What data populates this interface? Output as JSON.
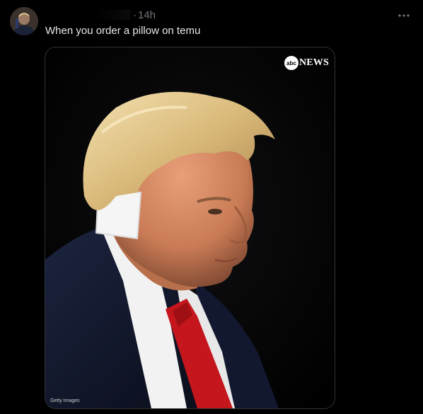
{
  "tweet": {
    "timestamp": "14h",
    "separator": "·",
    "text": "When you order a pillow on temu",
    "more_icon": "more-horizontal-icon",
    "avatar_icon": "avatar"
  },
  "media": {
    "watermark_logo": "abc",
    "watermark_label": "NEWS",
    "credit": "Getty Images"
  },
  "colors": {
    "background": "#000000",
    "text_primary": "#e7e9ea",
    "text_secondary": "#71767b",
    "border": "#2f3336",
    "tie_red": "#c4161c",
    "suit_navy": "#151b2e"
  }
}
